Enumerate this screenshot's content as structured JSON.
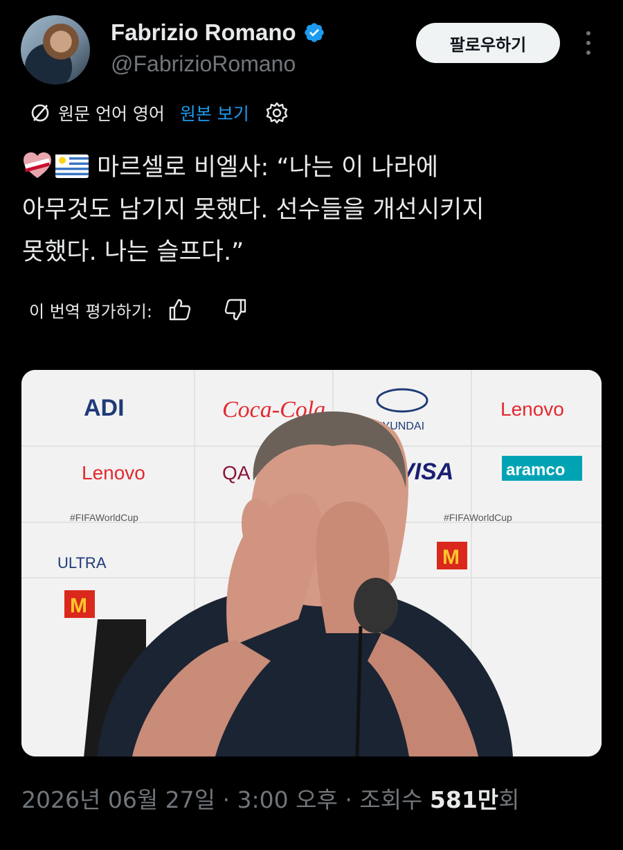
{
  "author": {
    "name": "Fabrizio Romano",
    "handle": "@FabrizioRomano",
    "verified_color": "#1d9bf0"
  },
  "follow_label": "팔로우하기",
  "translation": {
    "source_language": "원문 언어 영어",
    "show_original": "원본 보기"
  },
  "tweet": {
    "line1": "마르셀로 비엘사: “나는 이 나라에",
    "line2": "아무것도 남기지 못했다. 선수들을 개선시키지",
    "line3": "못했다. 나는 슬프다.”"
  },
  "rate_label": "이 번역 평가하기:",
  "photo": {
    "sponsors": [
      "ADI",
      "Coca-Cola",
      "HYUNDAI",
      "Lenovo",
      "Lenovo",
      "QA",
      "VISA",
      "aramco",
      "#FIFAWorldCup",
      "ULTRA",
      "M"
    ]
  },
  "meta": {
    "date": "2026년 06월 27일",
    "sep1": " · ",
    "time": "3:00 오후",
    "sep2": " · ",
    "views_label": "조회수 ",
    "views_value": "581만",
    "views_suffix": "회"
  },
  "colors": {
    "background": "#000000",
    "accent": "#1d9bf0",
    "muted": "#71767b"
  }
}
